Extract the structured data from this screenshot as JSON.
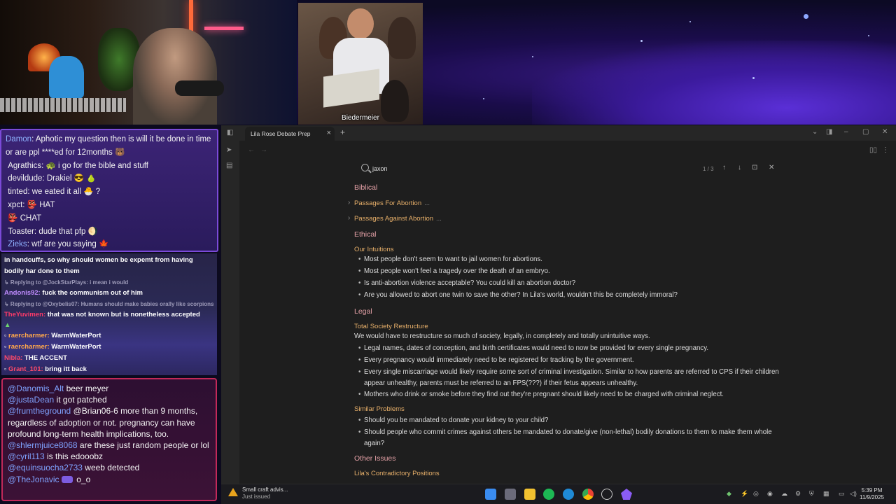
{
  "overlay": {
    "clip_caption": "Biedermeier"
  },
  "chat_top": [
    {
      "user": "Damon",
      "text": "Aphotic my question then is will it be done in time or are ppl ****ed for 12months 🐻",
      "color": "#8fb3ff"
    },
    {
      "user": "Agrathics",
      "text": "🐢 i go for the bible and stuff",
      "color": "#f2f2f2"
    },
    {
      "user": "devildude",
      "text": "Drakiel 😎 🍐",
      "color": "#f2f2f2"
    },
    {
      "user": "tinted",
      "text": "we eated it all 🐣 ?",
      "color": "#f2f2f2"
    },
    {
      "user": "xpct",
      "text": "👺 HAT",
      "color": "#f2f2f2"
    },
    {
      "user": "",
      "text": "👺 CHAT",
      "color": "#f2f2f2"
    },
    {
      "user": "Toaster",
      "text": "dude that pfp 🌖",
      "color": "#f2f2f2"
    },
    {
      "user": "Zieks",
      "text": "wtf are you saying 🍁",
      "color": "#8fb3ff"
    }
  ],
  "chat_mid": {
    "line1": "in handcuffs, so why should women be expemt from having bodily har done to them",
    "reply1": "↳ Replying to @JockStarPlays: i mean i would",
    "andonis_user": "Andonis92:",
    "andonis_text": "fuck the communism out of him",
    "reply2": "↳ Replying to @Oxybelis07: Humans should make babies orally like scorpions",
    "yuvimen_user": "TheYuvimen:",
    "yuvimen_text": "that was not known but is nonetheless accepted",
    "rc1_user": "raercharmer:",
    "rc1_text": "WarmWaterPort",
    "rc2_user": "raercharmer:",
    "rc2_text": "WarmWaterPort",
    "nibla_user": "Nibla:",
    "nibla_text": "THE ACCENT",
    "grant_user": "Grant_101:",
    "grant_text": "bring itt back"
  },
  "chat_bottom": [
    {
      "user": "@Danomis_Alt",
      "text": "beer meyer"
    },
    {
      "user": "@justaDean",
      "text": "it got patched"
    },
    {
      "user": "@frumtheground",
      "text": "@Brian06-6 more than 9 months, regardless of adoption or not. pregnancy can have profound long-term health implications, too."
    },
    {
      "user": "@shlermjuice8068",
      "text": "are these just random people or lol"
    },
    {
      "user": "@cyril113",
      "text": "is this edooobz"
    },
    {
      "user": "@equinsuocha2733",
      "text": "weeb detected"
    },
    {
      "user": "@TheJonavic",
      "text": "o_o"
    }
  ],
  "app": {
    "tab_title": "Lila Rose Debate Prep",
    "search": {
      "query": "jaxon",
      "count": "1 / 3"
    }
  },
  "doc": {
    "biblical": "Biblical",
    "passages_for": "Passages For Abortion",
    "passages_against": "Passages Against Abortion",
    "ellipsis": "...",
    "ethical": "Ethical",
    "our_intuitions": "Our Intuitions",
    "intuitions": [
      "Most people don't seem to want to jail women for abortions.",
      "Most people won't feel a tragedy over the death of an embryo.",
      "Is anti-abortion violence acceptable? You could kill an abortion doctor?",
      "Are you allowed to abort one twin to save the other? In Lila's world, wouldn't this be completely immoral?"
    ],
    "legal": "Legal",
    "total_society": "Total Society Restructure",
    "total_society_intro": "We would have to restructure so much of society, legally, in completely and totally unintuitive ways.",
    "restructure": [
      "Legal names, dates of conception, and birth certificates would need to now be provided for every single pregnancy.",
      "Every pregnancy would immediately need to be registered for tracking by the government.",
      "Every single miscarriage would likely require some sort of criminal investigation. Similar to how parents are referred to CPS if their children appear unhealthy, parents must be referred to an FPS(???) if their fetus appears unhealthy.",
      "Mothers who drink or smoke before they find out they're pregnant should likely need to be charged with criminal neglect."
    ],
    "similar_problems": "Similar Problems",
    "similar": [
      "Should you be mandated to donate your kidney to your child?",
      "Should people who commit crimes against others be mandated to donate/give (non-lethal) bodily donations to them to make them whole again?"
    ],
    "other_issues": "Other Issues",
    "contradictory": "Lila's Contradictory Positions"
  },
  "taskbar": {
    "weather_title": "Small craft advis...",
    "weather_sub": "Just issued",
    "time": "5:39 PM",
    "date": "11/9/2025"
  }
}
